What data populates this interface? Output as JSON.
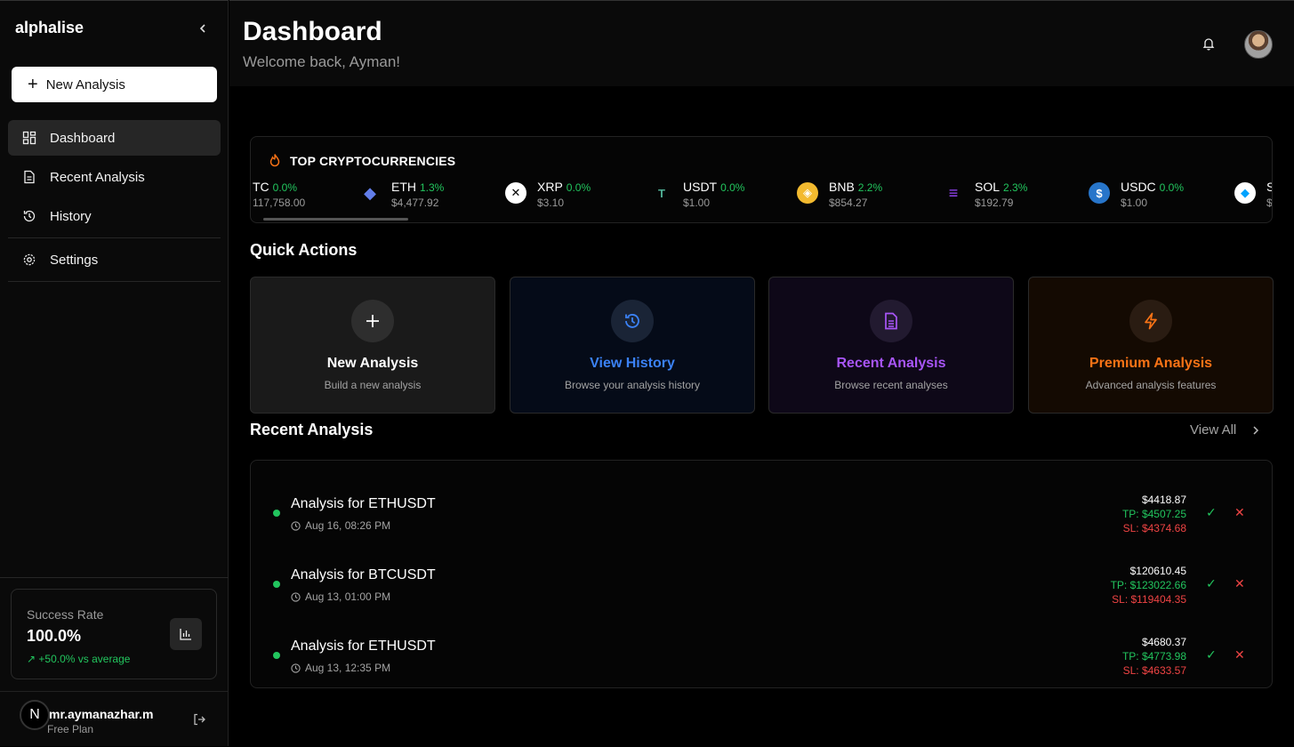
{
  "sidebar": {
    "brand": "alphalise",
    "new_button": "New Analysis",
    "nav": [
      {
        "label": "Dashboard",
        "icon": "grid-icon",
        "active": true
      },
      {
        "label": "Recent Analysis",
        "icon": "document-icon"
      },
      {
        "label": "History",
        "icon": "history-icon"
      },
      {
        "label": "Settings",
        "icon": "gear-icon"
      }
    ],
    "success": {
      "label": "Success Rate",
      "value": "100.0%",
      "delta": "+50.0% vs average"
    },
    "user": {
      "badge": "N",
      "name": "mr.aymanazhar.m",
      "plan": "Free Plan"
    }
  },
  "header": {
    "title": "Dashboard",
    "welcome": "Welcome back, Ayman!"
  },
  "crypto": {
    "title": "TOP CRYPTOCURRENCIES",
    "coins": [
      {
        "sym": "TC",
        "chg": "0.0%",
        "price": "117,758.00",
        "icon": "btc-icon",
        "color": "#f7931a"
      },
      {
        "sym": "ETH",
        "chg": "1.3%",
        "price": "$4,477.92",
        "icon": "eth-icon",
        "color": "#627eea"
      },
      {
        "sym": "XRP",
        "chg": "0.0%",
        "price": "$3.10",
        "icon": "xrp-icon",
        "color": "#ffffff"
      },
      {
        "sym": "USDT",
        "chg": "0.0%",
        "price": "$1.00",
        "icon": "usdt-icon",
        "color": "#50af95"
      },
      {
        "sym": "BNB",
        "chg": "2.2%",
        "price": "$854.27",
        "icon": "bnb-icon",
        "color": "#f3ba2f"
      },
      {
        "sym": "SOL",
        "chg": "2.3%",
        "price": "$192.79",
        "icon": "sol-icon",
        "color": "#9945ff"
      },
      {
        "sym": "USDC",
        "chg": "0.0%",
        "price": "$1.00",
        "icon": "usdc-icon",
        "color": "#2775ca"
      },
      {
        "sym": "S",
        "chg": "",
        "price": "$",
        "icon": "steth-icon",
        "color": "#00a3ff"
      }
    ]
  },
  "quick": {
    "title": "Quick Actions",
    "cards": [
      {
        "title": "New Analysis",
        "sub": "Build a new analysis",
        "icon": "plus-icon",
        "accent": "#ffffff",
        "bg": "#1a1a1a",
        "circle": "#2e2e2e"
      },
      {
        "title": "View History",
        "sub": "Browse your analysis history",
        "icon": "history-icon",
        "accent": "#3b82f6",
        "bg": "#050b18",
        "circle": "#1a2436"
      },
      {
        "title": "Recent Analysis",
        "sub": "Browse recent analyses",
        "icon": "document-icon",
        "accent": "#a855f7",
        "bg": "#0e0818",
        "circle": "#221a30"
      },
      {
        "title": "Premium Analysis",
        "sub": "Advanced analysis features",
        "icon": "lightning-icon",
        "accent": "#f97316",
        "bg": "#140a02",
        "circle": "#2a1c12"
      }
    ]
  },
  "recent": {
    "title": "Recent Analysis",
    "view_all": "View All",
    "rows": [
      {
        "title": "Analysis for ETHUSDT",
        "date": "Aug 16, 08:26 PM",
        "price": "$4418.87",
        "tp": "TP: $4507.25",
        "sl": "SL: $4374.68"
      },
      {
        "title": "Analysis for BTCUSDT",
        "date": "Aug 13, 01:00 PM",
        "price": "$120610.45",
        "tp": "TP: $123022.66",
        "sl": "SL: $119404.35"
      },
      {
        "title": "Analysis for ETHUSDT",
        "date": "Aug 13, 12:35 PM",
        "price": "$4680.37",
        "tp": "TP: $4773.98",
        "sl": "SL: $4633.57"
      }
    ],
    "ok": "✓",
    "no": "✕"
  }
}
